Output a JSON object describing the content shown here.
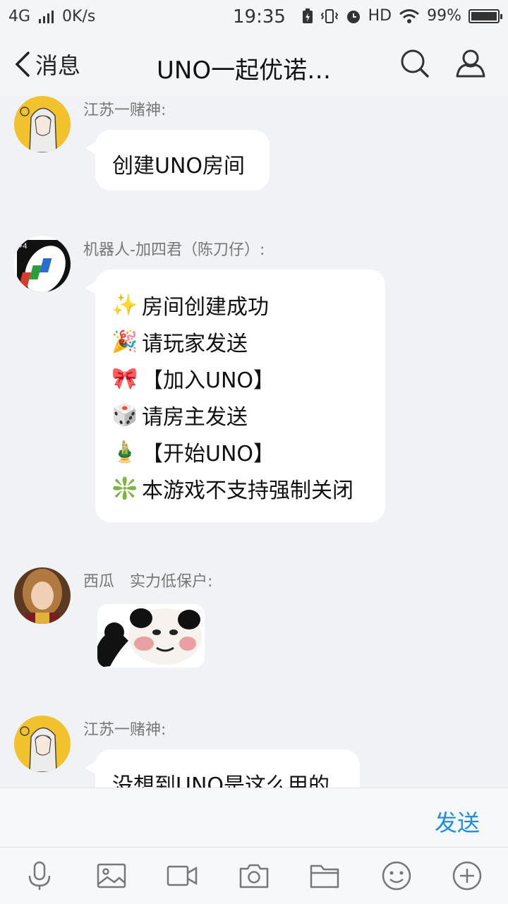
{
  "status_bar": {
    "network": "4G",
    "speed": "0K/s",
    "time": "19:35",
    "hd": "HD",
    "battery": "99%"
  },
  "header": {
    "back_label": "消息",
    "title": "UNO一起优诺…",
    "icons": [
      "search-icon",
      "group-members-icon"
    ]
  },
  "messages": [
    {
      "sender": "江苏一赌神:",
      "text": "创建UNO房间"
    },
    {
      "sender": "机器人-加四君（陈刀仔）:",
      "lines": [
        {
          "emoji": "✨",
          "text": "房间创建成功"
        },
        {
          "emoji": "🎉",
          "text": "请玩家发送"
        },
        {
          "emoji": "🎀",
          "text": "【加入UNO】"
        },
        {
          "emoji": "🎲",
          "text": "请房主发送"
        },
        {
          "emoji": "🎍",
          "text": "【开始UNO】"
        },
        {
          "emoji": "❇️",
          "text": "本游戏不支持强制关闭"
        }
      ]
    },
    {
      "sender": "西瓜　实力低保户:",
      "sticker": "panda-meme-sticker"
    },
    {
      "sender": "江苏一赌神:",
      "text": "没想到UNO是这么用的"
    }
  ],
  "input": {
    "send_label": "发送"
  },
  "toolbar_icons": [
    "microphone-icon",
    "image-icon",
    "video-icon",
    "camera-icon",
    "folder-icon",
    "emoji-icon",
    "plus-icon"
  ],
  "colors": {
    "accent": "#1d8ee0",
    "background": "#f0f2f5",
    "bubble": "#ffffff"
  }
}
